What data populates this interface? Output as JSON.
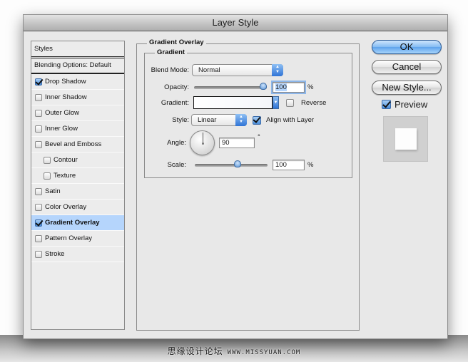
{
  "window": {
    "title": "Layer Style"
  },
  "styles_panel": {
    "header": "Styles",
    "blending": "Blending Options: Default",
    "items": [
      {
        "label": "Drop Shadow",
        "checked": true,
        "indent": false,
        "selected": false
      },
      {
        "label": "Inner Shadow",
        "checked": false,
        "indent": false,
        "selected": false
      },
      {
        "label": "Outer Glow",
        "checked": false,
        "indent": false,
        "selected": false
      },
      {
        "label": "Inner Glow",
        "checked": false,
        "indent": false,
        "selected": false
      },
      {
        "label": "Bevel and Emboss",
        "checked": false,
        "indent": false,
        "selected": false
      },
      {
        "label": "Contour",
        "checked": false,
        "indent": true,
        "selected": false
      },
      {
        "label": "Texture",
        "checked": false,
        "indent": true,
        "selected": false
      },
      {
        "label": "Satin",
        "checked": false,
        "indent": false,
        "selected": false
      },
      {
        "label": "Color Overlay",
        "checked": false,
        "indent": false,
        "selected": false
      },
      {
        "label": "Gradient Overlay",
        "checked": true,
        "indent": false,
        "selected": true
      },
      {
        "label": "Pattern Overlay",
        "checked": false,
        "indent": false,
        "selected": false
      },
      {
        "label": "Stroke",
        "checked": false,
        "indent": false,
        "selected": false
      }
    ]
  },
  "gradient_overlay": {
    "section_title": "Gradient Overlay",
    "group_title": "Gradient",
    "blend_mode": {
      "label": "Blend Mode:",
      "value": "Normal"
    },
    "opacity": {
      "label": "Opacity:",
      "value": "100",
      "unit": "%",
      "slider_percent": 100
    },
    "gradient": {
      "label": "Gradient:",
      "reverse_label": "Reverse",
      "reverse_checked": false
    },
    "style": {
      "label": "Style:",
      "value": "Linear",
      "align_label": "Align with Layer",
      "align_checked": true
    },
    "angle": {
      "label": "Angle:",
      "value": "90",
      "unit": "°",
      "degrees": 90
    },
    "scale": {
      "label": "Scale:",
      "value": "100",
      "unit": "%",
      "slider_percent": 60
    }
  },
  "buttons": {
    "ok": "OK",
    "cancel": "Cancel",
    "new_style": "New Style...",
    "preview_label": "Preview",
    "preview_checked": true
  },
  "watermark": {
    "text": "思缘设计论坛",
    "url": "WWW.MISSYUAN.COM"
  }
}
